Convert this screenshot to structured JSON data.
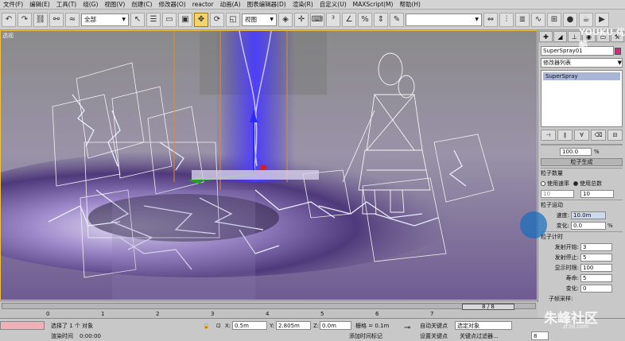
{
  "menu": [
    "文件(F)",
    "编辑(E)",
    "工具(T)",
    "组(G)",
    "视图(V)",
    "创建(C)",
    "修改器(O)",
    "reactor",
    "动画(A)",
    "图表编辑器(D)",
    "渲染(R)",
    "自定义(U)",
    "MAXScript(M)",
    "帮助(H)"
  ],
  "toolbar": {
    "selection_filter": "全部",
    "coord_system": "视图",
    "named_selection": ""
  },
  "viewport": {
    "label": "透视"
  },
  "command_panel": {
    "object_name": "SuperSpray01",
    "object_color": "#d4287e",
    "modifier_list": "修改器列表",
    "stack_item": "SuperSpray",
    "percent_value": "100.0",
    "percent_unit": "%",
    "rollout_particle_generation": "粒子生成",
    "group_quantity": "粒子数量",
    "radio_rate": "使用速率",
    "radio_total": "使用总数",
    "rate_value": "10",
    "total_value": "10",
    "group_motion": "粒子运动",
    "speed_label": "速度:",
    "speed_value": "10.0m",
    "variation_label": "变化:",
    "variation_value": "0.0",
    "group_timing": "粒子计时",
    "emit_start_label": "发射开始:",
    "emit_start_value": "3",
    "emit_stop_label": "发射停止:",
    "emit_stop_value": "5",
    "display_until_label": "显示时限:",
    "display_until_value": "100",
    "life_label": "寿命:",
    "life_value": "5",
    "life_var_label": "变化:",
    "life_var_value": "0",
    "subframe_label": "子帧采样:"
  },
  "timeline": {
    "frame_display": "8 / 8",
    "ticks": [
      "0",
      "1",
      "2",
      "3",
      "4",
      "5",
      "6",
      "7"
    ]
  },
  "statusbar": {
    "selected_text": "选择了 1 个 对象",
    "render_time_label": "渲染时间",
    "render_time_value": "0:00:00",
    "x_label": "X:",
    "x_value": "0.5m",
    "y_label": "Y:",
    "y_value": "2.805m",
    "z_label": "Z:",
    "z_value": "0.0m",
    "grid_label": "栅格 = 0.1m",
    "add_time_tag": "添加时间标记",
    "auto_key": "自动关键点",
    "set_key": "设置关键点",
    "selected_object": "选定对象",
    "key_filters": "关键点过滤器...",
    "frame_value": "8"
  },
  "watermark": {
    "top": "YOUKU 优酷",
    "bottom": "朱峰社区",
    "bottom_url": "zf3d.com"
  }
}
